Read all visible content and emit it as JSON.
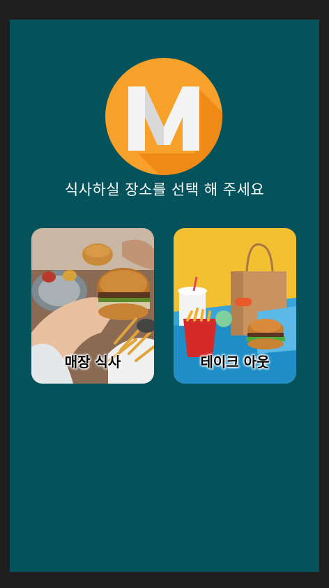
{
  "brand": {
    "logo_letter": "M",
    "logo_color": "#f7a12a"
  },
  "prompt": "식사하실 장소를 선택 해 주세요",
  "options": [
    {
      "label": "매장 식사",
      "icon": "burger-meal-photo"
    },
    {
      "label": "테이크 아웃",
      "icon": "takeout-bag-photo"
    }
  ],
  "colors": {
    "background": "#04525c",
    "frame": "#1f1f1f"
  }
}
